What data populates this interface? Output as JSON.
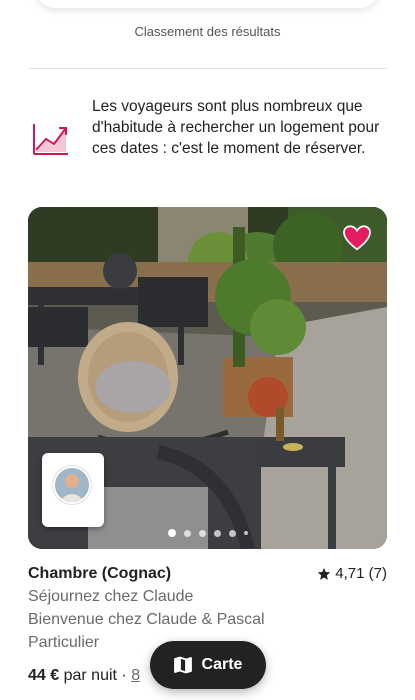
{
  "header": {
    "ranking_label": "Classement des résultats"
  },
  "insight": {
    "icon": "trending-up-chart-icon",
    "text": "Les voyageurs sont plus nombreux que d'habitude à rechercher un logement pour ces dates : c'est le moment de réserver."
  },
  "listing": {
    "title": "Chambre (Cognac)",
    "rating": "4,71 (7)",
    "line1": "Séjournez chez Claude",
    "line2": "Bienvenue chez Claude & Pascal",
    "line3": "Particulier",
    "price": "44 €",
    "price_suffix": "par nuit ·",
    "total": "8",
    "favorite_icon": "heart-icon",
    "photo_count": 6,
    "active_photo": 1
  },
  "map_button": {
    "label": "Carte",
    "icon": "map-icon"
  },
  "colors": {
    "accent": "#e31c5f",
    "text": "#222222",
    "muted": "#6a6a6a",
    "button_bg": "#222222"
  }
}
